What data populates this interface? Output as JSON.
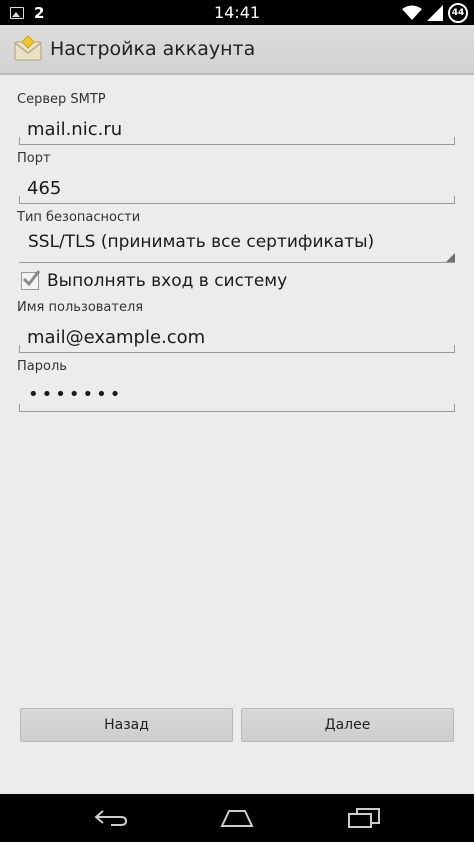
{
  "status_bar": {
    "notification_count": "2",
    "time": "14:41",
    "battery": "44"
  },
  "action_bar": {
    "title": "Настройка аккаунта",
    "icon": "email-envelope-icon"
  },
  "form": {
    "smtp_server": {
      "label": "Сервер SMTP",
      "value": "mail.nic.ru"
    },
    "port": {
      "label": "Порт",
      "value": "465"
    },
    "security": {
      "label": "Тип безопасности",
      "value": "SSL/TLS (принимать все сертификаты)"
    },
    "require_signin": {
      "label": "Выполнять вход в систему",
      "checked": true
    },
    "username": {
      "label": "Имя пользователя",
      "value": "mail@example.com"
    },
    "password": {
      "label": "Пароль",
      "value": "•••••••"
    }
  },
  "buttons": {
    "back": "Назад",
    "next": "Далее"
  },
  "colors": {
    "background": "#ececec",
    "action_bar": "#d6d6d6",
    "text": "#1a1a1a",
    "underline": "#9a9a9a"
  }
}
